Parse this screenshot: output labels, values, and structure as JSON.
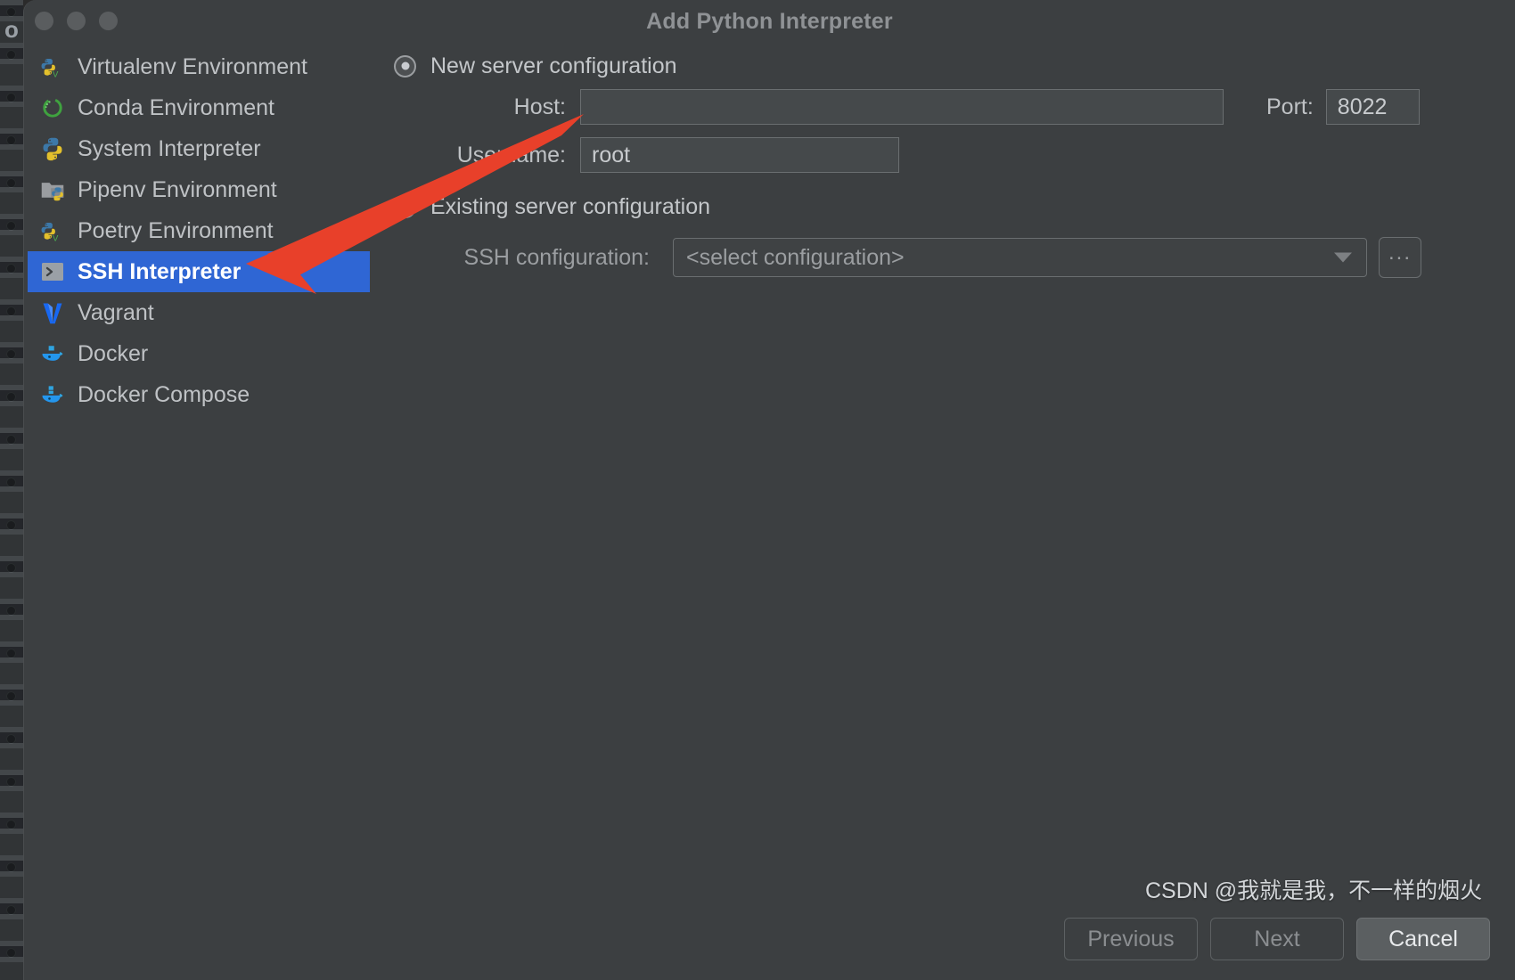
{
  "window": {
    "title": "Add Python Interpreter",
    "traffic_lights": [
      "close",
      "minimize",
      "zoom"
    ]
  },
  "sidebar": {
    "items": [
      {
        "label": "Virtualenv Environment",
        "icon": "python-venv-icon",
        "selected": false
      },
      {
        "label": "Conda Environment",
        "icon": "conda-icon",
        "selected": false
      },
      {
        "label": "System Interpreter",
        "icon": "python-icon",
        "selected": false
      },
      {
        "label": "Pipenv Environment",
        "icon": "pipenv-icon",
        "selected": false
      },
      {
        "label": "Poetry Environment",
        "icon": "poetry-icon",
        "selected": false
      },
      {
        "label": "SSH Interpreter",
        "icon": "ssh-terminal-icon",
        "selected": true
      },
      {
        "label": "Vagrant",
        "icon": "vagrant-icon",
        "selected": false
      },
      {
        "label": "Docker",
        "icon": "docker-icon",
        "selected": false
      },
      {
        "label": "Docker Compose",
        "icon": "docker-compose-icon",
        "selected": false
      }
    ]
  },
  "main": {
    "new_server": {
      "radio_label": "New server configuration",
      "selected": true,
      "host": {
        "label": "Host:",
        "value": "",
        "placeholder": ""
      },
      "port": {
        "label": "Port:",
        "value": "8022"
      },
      "username": {
        "label": "Username:",
        "value": "root"
      }
    },
    "existing_server": {
      "radio_label": "Existing server configuration",
      "selected": false,
      "ssh_configuration": {
        "label": "SSH configuration:",
        "value": "<select configuration>",
        "browse_button_label": "..."
      }
    }
  },
  "footer": {
    "previous_label": "Previous",
    "next_label": "Next",
    "cancel_label": "Cancel"
  },
  "watermark": {
    "text": "CSDN @我就是我，不一样的烟火"
  },
  "colors": {
    "dialog_background": "#3c3f41",
    "selection_blue": "#2f66d4",
    "text_primary": "#bfc2c5",
    "text_muted": "#9b9ea1",
    "annotation_red": "#e8402a",
    "field_background": "#45494b",
    "field_border": "#6a6e70"
  }
}
